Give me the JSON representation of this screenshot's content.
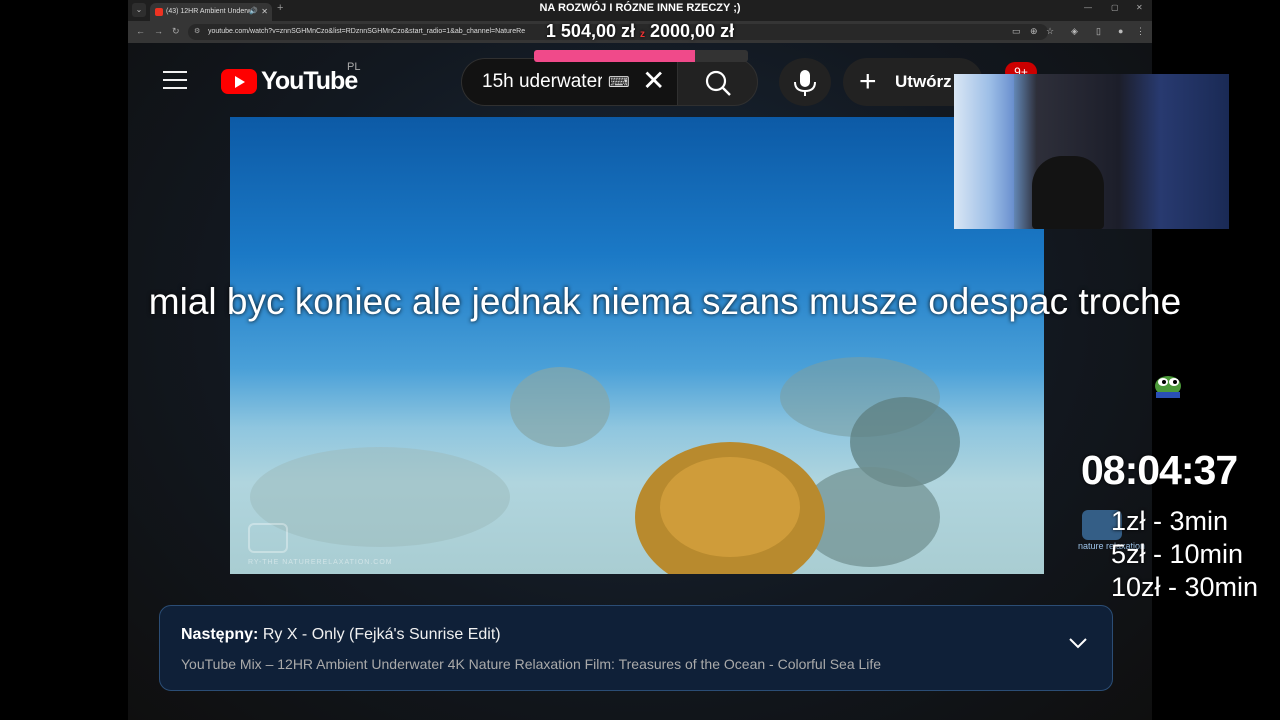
{
  "stream": {
    "title": "NA ROZWÓJ I RÓZNE INNE RZECZY ;)",
    "goal_current": "1 504,00 zł",
    "goal_separator": "z",
    "goal_target": "2000,00 zł",
    "goal_progress": 0.752,
    "caption": "mial byc koniec ale jednak niema szans musze odespac troche",
    "timer": "08:04:37",
    "rates": [
      "1zł - 3min",
      "5zł - 10min",
      "10zł - 30min"
    ],
    "tip_logo_text": "nature relaxation"
  },
  "browser": {
    "tab_title": "(43) 12HR Ambient Underw",
    "url": "youtube.com/watch?v=znnSGHMnCzo&list=RDznnSGHMnCzo&start_radio=1&ab_channel=NatureRe"
  },
  "youtube": {
    "logo_text": "YouTube",
    "country": "PL",
    "search_value": "15h uderwater",
    "create_label": "Utwórz",
    "notifications": "9+"
  },
  "video": {
    "watermark_text": "RY-THE   NATURERELAXATION.COM"
  },
  "up_next": {
    "label": "Następny:",
    "title": "Ry X - Only (Fejká's Sunrise Edit)",
    "mix": "YouTube Mix – 12HR Ambient Underwater 4K Nature Relaxation Film: Treasures of the Ocean - Colorful Sea Life"
  },
  "colors": {
    "yt_red": "#ff0000",
    "card_bg": "#0f2038",
    "goal_fill": "#f04a8a"
  }
}
